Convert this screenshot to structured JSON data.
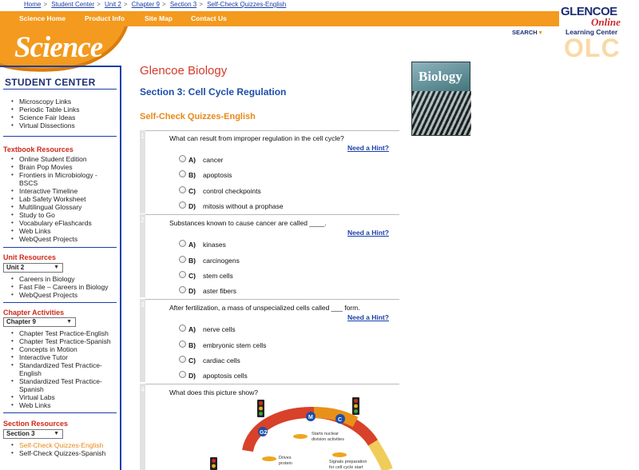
{
  "breadcrumb": [
    "Home",
    "Student Center",
    "Unit 2",
    "Chapter 9",
    "Section 3",
    "Self-Check Quizzes-English"
  ],
  "topnav": [
    "Science Home",
    "Product Info",
    "Site Map",
    "Contact Us"
  ],
  "logo": {
    "text": "Science"
  },
  "brand": {
    "glencoe": "GLENCOE",
    "online": "Online",
    "learning_center": "Learning Center",
    "olc": "OLC",
    "search": "SEARCH"
  },
  "sidebar": {
    "title": "STUDENT CENTER",
    "top_links": [
      "Microscopy Links",
      "Periodic Table Links",
      "Science Fair Ideas",
      "Virtual Dissections"
    ],
    "textbook_heading": "Textbook Resources",
    "textbook_links": [
      "Online Student Edition",
      "Brain Pop Movies",
      "Frontiers in Microbiology - BSCS",
      "Interactive Timeline",
      "Lab Safety Worksheet",
      "Multilingual Glossary",
      "Study to Go",
      "Vocabulary eFlashcards",
      "Web Links",
      "WebQuest Projects"
    ],
    "unit_heading": "Unit Resources",
    "unit_select": "Unit 2",
    "unit_links": [
      "Careers in Biology",
      "Fast File – Careers in Biology",
      "WebQuest Projects"
    ],
    "chapter_heading": "Chapter Activities",
    "chapter_select": "Chapter 9",
    "chapter_links": [
      "Chapter Test Practice-English",
      "Chapter Test Practice-Spanish",
      "Concepts in Motion",
      "Interactive Tutor",
      "Standardized Test Practice-English",
      "Standardized Test Practice-Spanish",
      "Virtual Labs",
      "Web Links"
    ],
    "section_heading": "Section Resources",
    "section_select": "Section 3",
    "section_links": [
      "Self-Check Quizzes-English",
      "Self-Check Quizzes-Spanish"
    ]
  },
  "main": {
    "book": "Glencoe Biology",
    "section": "Section 3: Cell Cycle Regulation",
    "quiz": "Self-Check Quizzes-English",
    "cover_title": "Biology",
    "hint_label": "Need a Hint?",
    "questions": [
      {
        "num": "1",
        "text": "What can result from improper regulation in the cell cycle?",
        "options": [
          {
            "letter": "A)",
            "text": "cancer"
          },
          {
            "letter": "B)",
            "text": "apoptosis"
          },
          {
            "letter": "C)",
            "text": "control checkpoints"
          },
          {
            "letter": "D)",
            "text": "mitosis without a prophase"
          }
        ]
      },
      {
        "num": "2",
        "text": "Substances known to cause cancer are called ____.",
        "options": [
          {
            "letter": "A)",
            "text": "kinases"
          },
          {
            "letter": "B)",
            "text": "carcinogens"
          },
          {
            "letter": "C)",
            "text": "stem cells"
          },
          {
            "letter": "D)",
            "text": "aster fibers"
          }
        ]
      },
      {
        "num": "3",
        "text": "After fertilization, a mass of unspecialized cells called ___ form.",
        "options": [
          {
            "letter": "A)",
            "text": "nerve cells"
          },
          {
            "letter": "B)",
            "text": "embryonic stem cells"
          },
          {
            "letter": "C)",
            "text": "cardiac cells"
          },
          {
            "letter": "D)",
            "text": "apoptosis cells"
          }
        ]
      },
      {
        "num": "4",
        "text": "What does this picture show?"
      }
    ],
    "diagram": {
      "m": "M",
      "c": "C",
      "g2": "G2",
      "label1": "Starts nuclear division activities",
      "label2": "Drives protein synthesis",
      "label3": "Signals preparation for cell cycle start"
    }
  },
  "colors": {
    "orange": "#f39a1f",
    "blue": "#1a3ea8",
    "red": "#d63a2a"
  }
}
